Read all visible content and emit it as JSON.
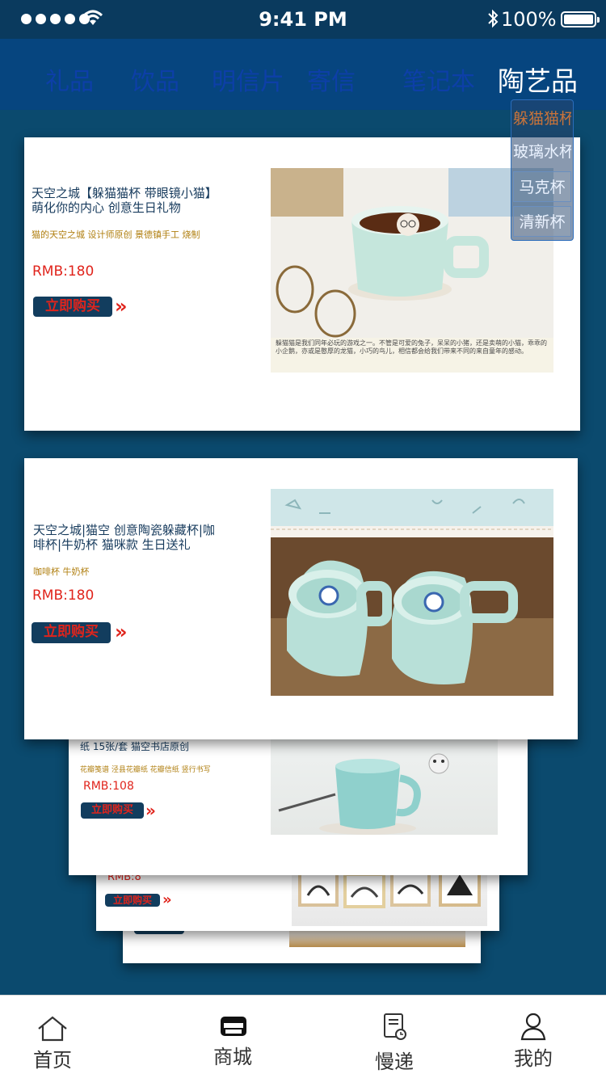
{
  "status": {
    "time": "9:41 PM",
    "battery": "100%"
  },
  "categories": [
    "礼品",
    "饮品",
    "明信片",
    "寄信",
    "笔记本",
    "陶艺品"
  ],
  "submenu": [
    "躲猫猫杯",
    "玻璃水杯",
    "马克杯",
    "清新杯"
  ],
  "cards": [
    {
      "title": "天空之城【躲猫猫杯 带眼镜小猫】萌化你的内心 创意生日礼物",
      "subtitle": "猫的天空之城 设计师原创 景德镇手工 烧制",
      "price": "RMB:180",
      "buy_label": "立即购买",
      "caption": "躲猫猫是我们同年必玩的游戏之一。不管是可爱的兔子，呆呆的小猪，还是卖萌的小猫，乖乖的小企鹅，亦或是憨厚的龙猫，小巧的鸟儿，相信都会给我们带来不同的来自童年的感动。"
    },
    {
      "title": "天空之城|猫空 创意陶瓷躲藏杯|咖啡杯|牛奶杯 猫咪款 生日送礼",
      "subtitle": "咖啡杯 牛奶杯",
      "price": "RMB:180",
      "buy_label": "立即购买"
    },
    {
      "title": "纸 15张/套 猫空书店原创",
      "subtitle": "花瓣笺谱 泾县花瓣纸 花瓣信纸 竖行书写",
      "price": "RMB:108",
      "buy_label": "立即购买"
    },
    {
      "price": "RMB:8",
      "buy_label": "立即购买"
    }
  ],
  "tabs": [
    {
      "label": "首页",
      "icon": "home-icon"
    },
    {
      "label": "商城",
      "icon": "store-icon"
    },
    {
      "label": "慢递",
      "icon": "slow-mail-icon"
    },
    {
      "label": "我的",
      "icon": "profile-icon"
    }
  ],
  "colors": {
    "background": "#0b4a6e",
    "nav": "#06457f",
    "price": "#e0241c",
    "button": "#123d5e"
  }
}
